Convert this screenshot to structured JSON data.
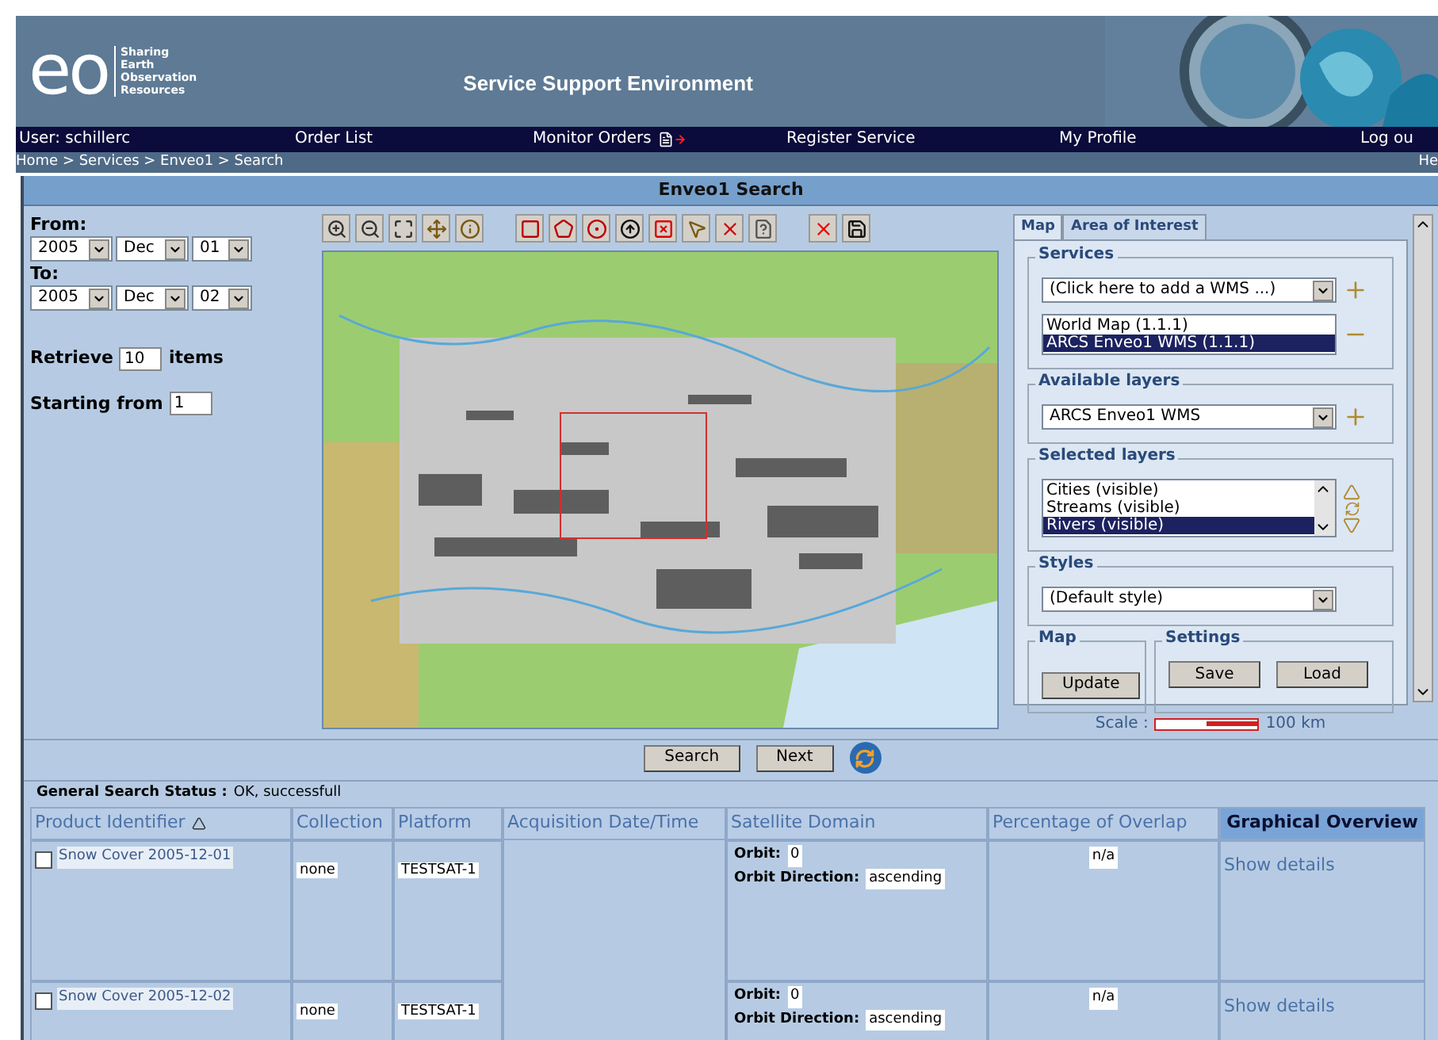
{
  "header": {
    "logo_text": "eo",
    "tagline": [
      "Sharing",
      "Earth",
      "Observation",
      "Resources"
    ],
    "title": "Service Support Environment"
  },
  "nav": [
    {
      "label": "User: schillerc",
      "kind": "text"
    },
    {
      "label": "Order List",
      "kind": "link"
    },
    {
      "label": "Monitor Orders",
      "kind": "link_icon"
    },
    {
      "label": "Register Service",
      "kind": "link"
    },
    {
      "label": "My Profile",
      "kind": "link"
    },
    {
      "label": "Log ou",
      "kind": "link"
    }
  ],
  "breadcrumb": {
    "path": "Home > Services > Enveo1 > Search",
    "help": "He"
  },
  "panel_title": "Enveo1 Search",
  "form": {
    "from_label": "From:",
    "from": [
      "2005",
      "Dec",
      "01"
    ],
    "to_label": "To:",
    "to": [
      "2005",
      "Dec",
      "02"
    ],
    "retrieve_label": "Retrieve",
    "retrieve": "10",
    "retrieve_unit": "items",
    "start_label": "Starting from",
    "start": "1"
  },
  "side": {
    "tabs": [
      {
        "label": "Map",
        "selected": true
      },
      {
        "label": "Area of Interest",
        "selected": false
      }
    ],
    "services": {
      "legend": "Services",
      "dropdown": "(Click here to add a WMS ...)",
      "items": [
        {
          "label": "World Map (1.1.1)",
          "selected": false
        },
        {
          "label": "ARCS Enveo1 WMS (1.1.1)",
          "selected": true
        }
      ]
    },
    "available": {
      "legend": "Available layers",
      "dropdown": "ARCS Enveo1 WMS"
    },
    "layers": {
      "legend": "Selected layers",
      "items": [
        {
          "label": "Cities (visible)",
          "selected": false
        },
        {
          "label": "Streams (visible)",
          "selected": false
        },
        {
          "label": "Rivers (visible)",
          "selected": true
        }
      ]
    },
    "styles": {
      "legend": "Styles",
      "dropdown": "(Default style)"
    },
    "map": {
      "legend": "Map",
      "button": "Update"
    },
    "settings": {
      "legend": "Settings",
      "buttons": [
        "Save",
        "Load"
      ]
    },
    "scale": {
      "label": "Scale :",
      "reading": "100 km"
    }
  },
  "actions": [
    "Search",
    "Next"
  ],
  "status": {
    "label": "General Search Status :",
    "value": "OK, successfull"
  },
  "table": {
    "columns": [
      {
        "label": "Product Identifier",
        "sorted_ascending": true,
        "highlighted": false
      },
      {
        "label": "Collection",
        "sorted_ascending": false,
        "highlighted": false
      },
      {
        "label": "Platform",
        "sorted_ascending": false,
        "highlighted": false
      },
      {
        "label": "Acquisition Date/Time",
        "sorted_ascending": false,
        "highlighted": false
      },
      {
        "label": "Satellite Domain",
        "sorted_ascending": false,
        "highlighted": false
      },
      {
        "label": "Percentage of Overlap",
        "sorted_ascending": false,
        "highlighted": false
      },
      {
        "label": "Graphical Overview",
        "sorted_ascending": false,
        "highlighted": true
      }
    ],
    "rows": [
      {
        "checked": false,
        "product": "Snow Cover 2005-12-01",
        "collection": "none",
        "platform": "TESTSAT-1",
        "orbit_label": "Orbit:",
        "orbit": "0",
        "direction_label": "Orbit Direction:",
        "direction": "ascending",
        "overlap": "n/a",
        "link": "Show details"
      },
      {
        "checked": false,
        "product": "Snow Cover 2005-12-02",
        "collection": "none",
        "platform": "TESTSAT-1",
        "orbit_label": "Orbit:",
        "orbit": "0",
        "direction_label": "Orbit Direction:",
        "direction": "ascending",
        "overlap": "n/a",
        "link": "Show details"
      }
    ]
  }
}
